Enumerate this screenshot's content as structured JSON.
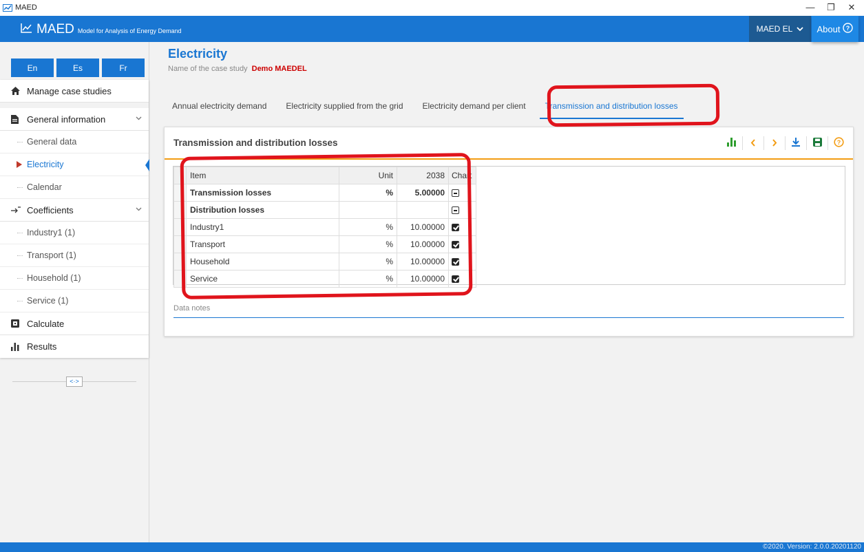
{
  "window": {
    "title": "MAED",
    "controls": {
      "minimize": "—",
      "maximize": "❐",
      "close": "✕"
    }
  },
  "header": {
    "brand_name": "MAED",
    "brand_subtitle": "Model for Analysis of Energy Demand",
    "model_select": "MAED EL",
    "about_label": "About"
  },
  "sidebar": {
    "languages": [
      "En",
      "Es",
      "Fr"
    ],
    "manage_label": "Manage case studies",
    "general_label": "General information",
    "general_items": [
      "General data",
      "Electricity",
      "Calendar"
    ],
    "coefficients_label": "Coefficients",
    "coefficient_items": [
      "Industry1 (1)",
      "Transport (1)",
      "Household (1)",
      "Service (1)"
    ],
    "calculate_label": "Calculate",
    "results_label": "Results",
    "collapse_label": "<·>"
  },
  "page": {
    "title": "Electricity",
    "case_label": "Name of the case study",
    "case_name": "Demo MAEDEL"
  },
  "tabs": [
    "Annual electricity demand",
    "Electricity supplied from the grid",
    "Electricity demand per client",
    "Transmission and distribution losses"
  ],
  "card": {
    "title": "Transmission and distribution losses",
    "notes_label": "Data notes"
  },
  "table": {
    "headers": {
      "item": "Item",
      "unit": "Unit",
      "year": "2038",
      "chart": "Chart"
    },
    "rows": [
      {
        "item": "Transmission losses",
        "unit": "%",
        "value": "5.00000",
        "chart": "minus",
        "bold": true
      },
      {
        "item": "Distribution losses",
        "unit": "",
        "value": "",
        "chart": "minus",
        "bold": true
      },
      {
        "item": "Industry1",
        "unit": "%",
        "value": "10.00000",
        "chart": "check",
        "bold": false
      },
      {
        "item": "Transport",
        "unit": "%",
        "value": "10.00000",
        "chart": "check",
        "bold": false
      },
      {
        "item": "Household",
        "unit": "%",
        "value": "10.00000",
        "chart": "check",
        "bold": false
      },
      {
        "item": "Service",
        "unit": "%",
        "value": "10.00000",
        "chart": "check",
        "bold": false
      }
    ]
  },
  "footer": {
    "text": "©2020. Version: 2.0.0.20201120"
  },
  "colors": {
    "primary": "#1976d2",
    "accent": "#f39c12",
    "highlight": "#e0141c",
    "case_name": "#cc0000"
  }
}
